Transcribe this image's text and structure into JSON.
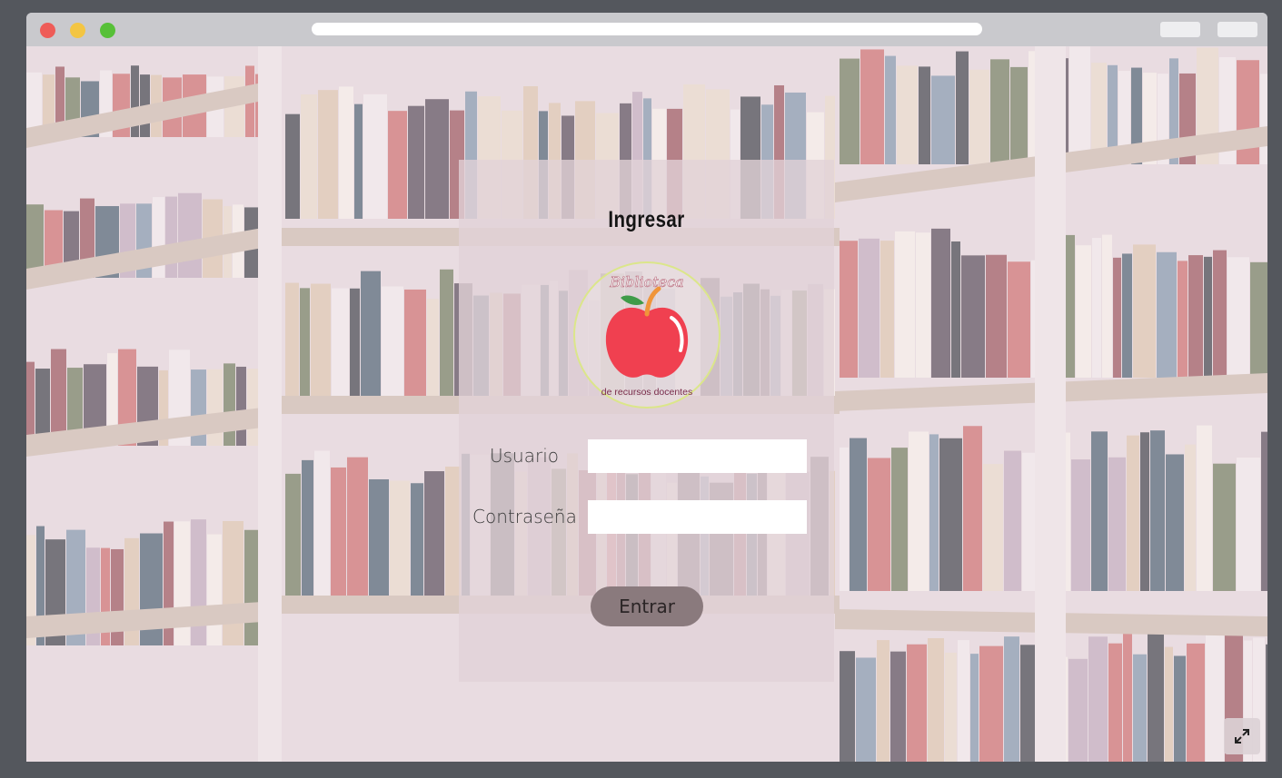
{
  "login": {
    "title": "Ingresar",
    "logo_text_top": "Biblioteca",
    "logo_text_bottom": "de recursos docentes",
    "user_label": "Usuario",
    "user_value": "",
    "password_label": "Contraseña",
    "password_value": "",
    "submit_label": "Entrar"
  },
  "window": {
    "url": ""
  },
  "icons": {
    "logo": "apple-logo-icon",
    "expand": "expand-icon"
  },
  "colors": {
    "button": "#8a7a7d",
    "logo_apple": "#f04050",
    "logo_ring": "#dbe68a"
  }
}
